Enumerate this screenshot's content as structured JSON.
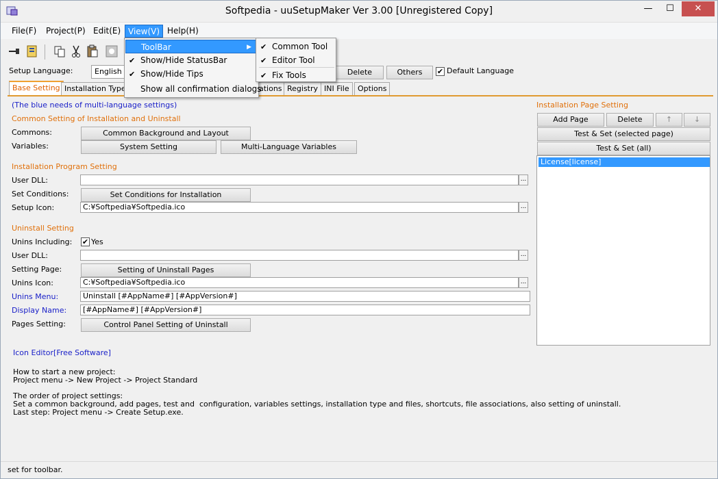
{
  "window": {
    "title": "Softpedia - uuSetupMaker Ver 3.00 [Unregistered Copy]",
    "min_glyph": "—",
    "max_glyph": "☐",
    "close_glyph": "✕"
  },
  "menubar": {
    "items": [
      "File(F)",
      "Project(P)",
      "Edit(E)",
      "View(V)",
      "Help(H)"
    ],
    "active": "View(V)"
  },
  "toolbar": {
    "icons": [
      "pin-icon",
      "project-icon",
      "copy-icon",
      "cut-icon",
      "paste-icon",
      "share-icon"
    ]
  },
  "language_row": {
    "label": "Setup Language:",
    "combo_value": "English",
    "delete_label": "Delete",
    "others_label": "Others",
    "default_checked": true,
    "default_label": "Default Language"
  },
  "tabs": {
    "items": [
      "Base Setting",
      "Installation Type",
      "ations",
      "Registry",
      "INI File",
      "Options"
    ],
    "active": "Base Setting"
  },
  "base_setting": {
    "note": "(The blue needs of multi-language settings)",
    "common_header": "Common Setting of Installation and Uninstall",
    "commons_label": "Commons:",
    "common_bg_button": "Common Background and Layout",
    "variables_label": "Variables:",
    "system_setting_button": "System Setting",
    "multi_lang_button": "Multi-Language Variables",
    "install_header": "Installation Program Setting",
    "user_dll_label": "User DLL:",
    "user_dll_value": "",
    "set_conditions_label": "Set Conditions:",
    "set_conditions_button": "Set Conditions for Installation",
    "setup_icon_label": "Setup Icon:",
    "setup_icon_value": "C:¥Softpedia¥Softpedia.ico",
    "uninstall_header": "Uninstall Setting",
    "unins_including_label": "Unins Including:",
    "unins_including_checked": true,
    "unins_including_yes": "Yes",
    "unins_user_dll_label": "User DLL:",
    "unins_user_dll_value": "",
    "setting_page_label": "Setting Page:",
    "setting_page_button": "Setting of Uninstall Pages",
    "unins_icon_label": "Unins Icon:",
    "unins_icon_value": "C:¥Softpedia¥Softpedia.ico",
    "unins_menu_label": "Unins Menu:",
    "unins_menu_value": "Uninstall [#AppName#] [#AppVersion#]",
    "display_name_label": "Display Name:",
    "display_name_value": "[#AppName#] [#AppVersion#]",
    "pages_setting_label": "Pages Setting:",
    "control_panel_button": "Control Panel Setting of Uninstall",
    "icon_editor_link": "Icon Editor[Free Software]",
    "help_start": "How to start a new project:\nProject menu -> New Project -> Project Standard",
    "help_order": "The order of project settings:\nSet a common background, add pages, test and  configuration, variables settings, installation type and files, shortcuts, file associations, also setting of uninstall.\nLast step: Project menu -> Create Setup.exe."
  },
  "install_page": {
    "header": "Installation Page Setting",
    "add_page": "Add Page",
    "delete": "Delete",
    "up": "↑",
    "down": "↓",
    "test_selected": "Test & Set (selected page)",
    "test_all": "Test & Set (all)",
    "pages": [
      "License[license]"
    ]
  },
  "view_menu": {
    "items": [
      {
        "label": "ToolBar",
        "checked": false,
        "submenu": true
      },
      {
        "label": "Show/Hide StatusBar",
        "checked": true
      },
      {
        "label": "Show/Hide Tips",
        "checked": true
      },
      {
        "label": "Show all confirmation dialogs",
        "checked": false
      }
    ]
  },
  "toolbar_submenu": {
    "items": [
      {
        "label": "Common Tool",
        "checked": true
      },
      {
        "label": "Editor Tool",
        "checked": true
      },
      {
        "label": "Fix Tools",
        "checked": true
      }
    ]
  },
  "statusbar": {
    "text": "set for toolbar."
  }
}
